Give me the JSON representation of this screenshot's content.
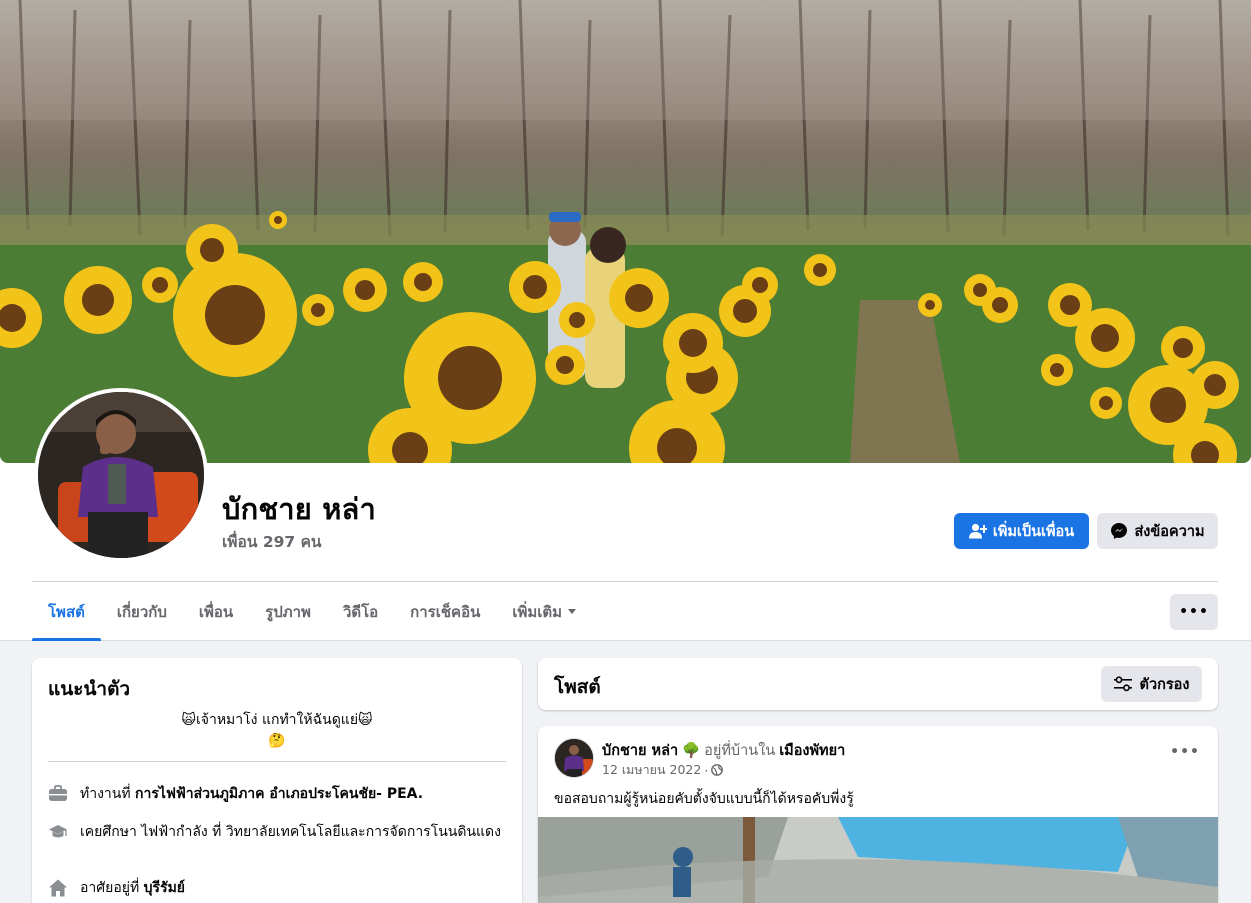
{
  "profile": {
    "name": "บักชาย หล่า",
    "friends_text": "เพื่อน 297 คน",
    "add_friend_label": "เพิ่มเป็นเพื่อน",
    "message_label": "ส่งข้อความ",
    "more_label": "•••"
  },
  "tabs": [
    {
      "label": "โพสต์",
      "active": true
    },
    {
      "label": "เกี่ยวกับ"
    },
    {
      "label": "เพื่อน"
    },
    {
      "label": "รูปภาพ"
    },
    {
      "label": "วิดีโอ"
    },
    {
      "label": "การเช็คอิน"
    },
    {
      "label": "เพิ่มเติม"
    }
  ],
  "intro": {
    "title": "แนะนำตัว",
    "bio_line1": "🙀เจ้าหมาโง่ แกทำให้ฉันดูแย่🙀",
    "bio_line2": "🤔",
    "work_prefix": "ทำงานที่ ",
    "work_place": "การไฟฟ้าส่วนภูมิภาค อำเภอประโคนชัย- PEA.",
    "edu_text": "เคยศึกษา ไฟฟ้ากำลัง ที่ วิทยาลัยเทคโนโลยีและการจัดการโนนดินแดง",
    "home_prefix": "อาศัยอยู่ที่ ",
    "home_place": "บุรีรัมย์"
  },
  "posts": {
    "title": "โพสต์",
    "filter_label": "ตัวกรอง",
    "post": {
      "author": "บักชาย หล่า",
      "emoji": "🌳",
      "status_text": "อยู่ที่บ้านใน",
      "place": "เมืองพัทยา",
      "date": "12 เมษายน 2022",
      "separator": "·",
      "text": "ขอสอบถามผู้รู้หน่อยคับตั้งจับแบบนี้ก็ได้หรอคับพี่งรู้",
      "more_label": "•••"
    }
  },
  "icons": {
    "add_friend": "person-add-icon",
    "messenger": "messenger-icon",
    "work": "briefcase-icon",
    "education": "graduation-cap-icon",
    "home": "home-icon",
    "filter": "sliders-icon",
    "privacy": "globe-icon"
  },
  "colors": {
    "accent": "#1b74e4",
    "muted": "#65676b",
    "background": "#f0f2f5"
  }
}
